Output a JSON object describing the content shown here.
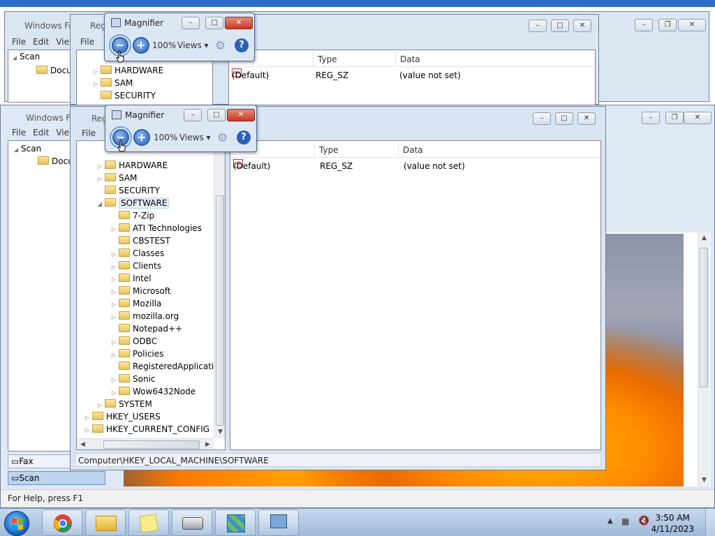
{
  "top_window": {
    "fax_title": "Windows Fa",
    "reg_title": "Reg",
    "fax_menu": [
      "File",
      "Edit",
      "Vie"
    ],
    "reg_menu": [
      "File"
    ],
    "fax_tree": [
      "Scan",
      "Docu"
    ],
    "reg_tree": [
      "HARDWARE",
      "SAM",
      "SECURITY"
    ],
    "columns": [
      "Type",
      "Data"
    ],
    "row": {
      "name": "(Default)",
      "type": "REG_SZ",
      "data": "(value not set)"
    },
    "magnifier": {
      "title": "Magnifier",
      "zoom": "100%",
      "views": "Views"
    }
  },
  "fax": {
    "title": "Windows Fa",
    "menu": [
      "File",
      "Edit",
      "Vie"
    ],
    "tree": [
      "Scan",
      "Docu"
    ],
    "folders": [
      "Fax",
      "Scan"
    ],
    "status": "For Help, press F1"
  },
  "regedit": {
    "title": "Reg",
    "menu": [
      "File"
    ],
    "tree": [
      {
        "label": "HARDWARE",
        "level": 1,
        "expand": "collapsed"
      },
      {
        "label": "SAM",
        "level": 1,
        "expand": "collapsed"
      },
      {
        "label": "SECURITY",
        "level": 1,
        "expand": "none"
      },
      {
        "label": "SOFTWARE",
        "level": 1,
        "expand": "expanded",
        "selected": true
      },
      {
        "label": "7-Zip",
        "level": 2,
        "expand": "none"
      },
      {
        "label": "ATI Technologies",
        "level": 2,
        "expand": "collapsed"
      },
      {
        "label": "CBSTEST",
        "level": 2,
        "expand": "none"
      },
      {
        "label": "Classes",
        "level": 2,
        "expand": "collapsed"
      },
      {
        "label": "Clients",
        "level": 2,
        "expand": "collapsed"
      },
      {
        "label": "Intel",
        "level": 2,
        "expand": "collapsed"
      },
      {
        "label": "Microsoft",
        "level": 2,
        "expand": "collapsed"
      },
      {
        "label": "Mozilla",
        "level": 2,
        "expand": "collapsed"
      },
      {
        "label": "mozilla.org",
        "level": 2,
        "expand": "collapsed"
      },
      {
        "label": "Notepad++",
        "level": 2,
        "expand": "none"
      },
      {
        "label": "ODBC",
        "level": 2,
        "expand": "collapsed"
      },
      {
        "label": "Policies",
        "level": 2,
        "expand": "collapsed"
      },
      {
        "label": "RegisteredApplications",
        "level": 2,
        "expand": "none"
      },
      {
        "label": "Sonic",
        "level": 2,
        "expand": "collapsed"
      },
      {
        "label": "Wow6432Node",
        "level": 2,
        "expand": "collapsed"
      },
      {
        "label": "SYSTEM",
        "level": 1,
        "expand": "collapsed"
      },
      {
        "label": "HKEY_USERS",
        "level": 0,
        "expand": "collapsed"
      },
      {
        "label": "HKEY_CURRENT_CONFIG",
        "level": 0,
        "expand": "collapsed"
      }
    ],
    "columns": [
      "Type",
      "Data"
    ],
    "rows": [
      {
        "name": "(Default)",
        "type": "REG_SZ",
        "data": "(value not set)"
      }
    ],
    "status_path": "Computer\\HKEY_LOCAL_MACHINE\\SOFTWARE"
  },
  "magnifier": {
    "title": "Magnifier",
    "zoom": "100%",
    "views": "Views"
  },
  "taskbar": {
    "apps": [
      "chrome-icon",
      "explorer-icon",
      "sticky-notes-icon",
      "fax-scan-icon",
      "regedit-icon",
      "magnifier-icon"
    ],
    "time": "3:50 AM",
    "date": "4/11/2023"
  }
}
